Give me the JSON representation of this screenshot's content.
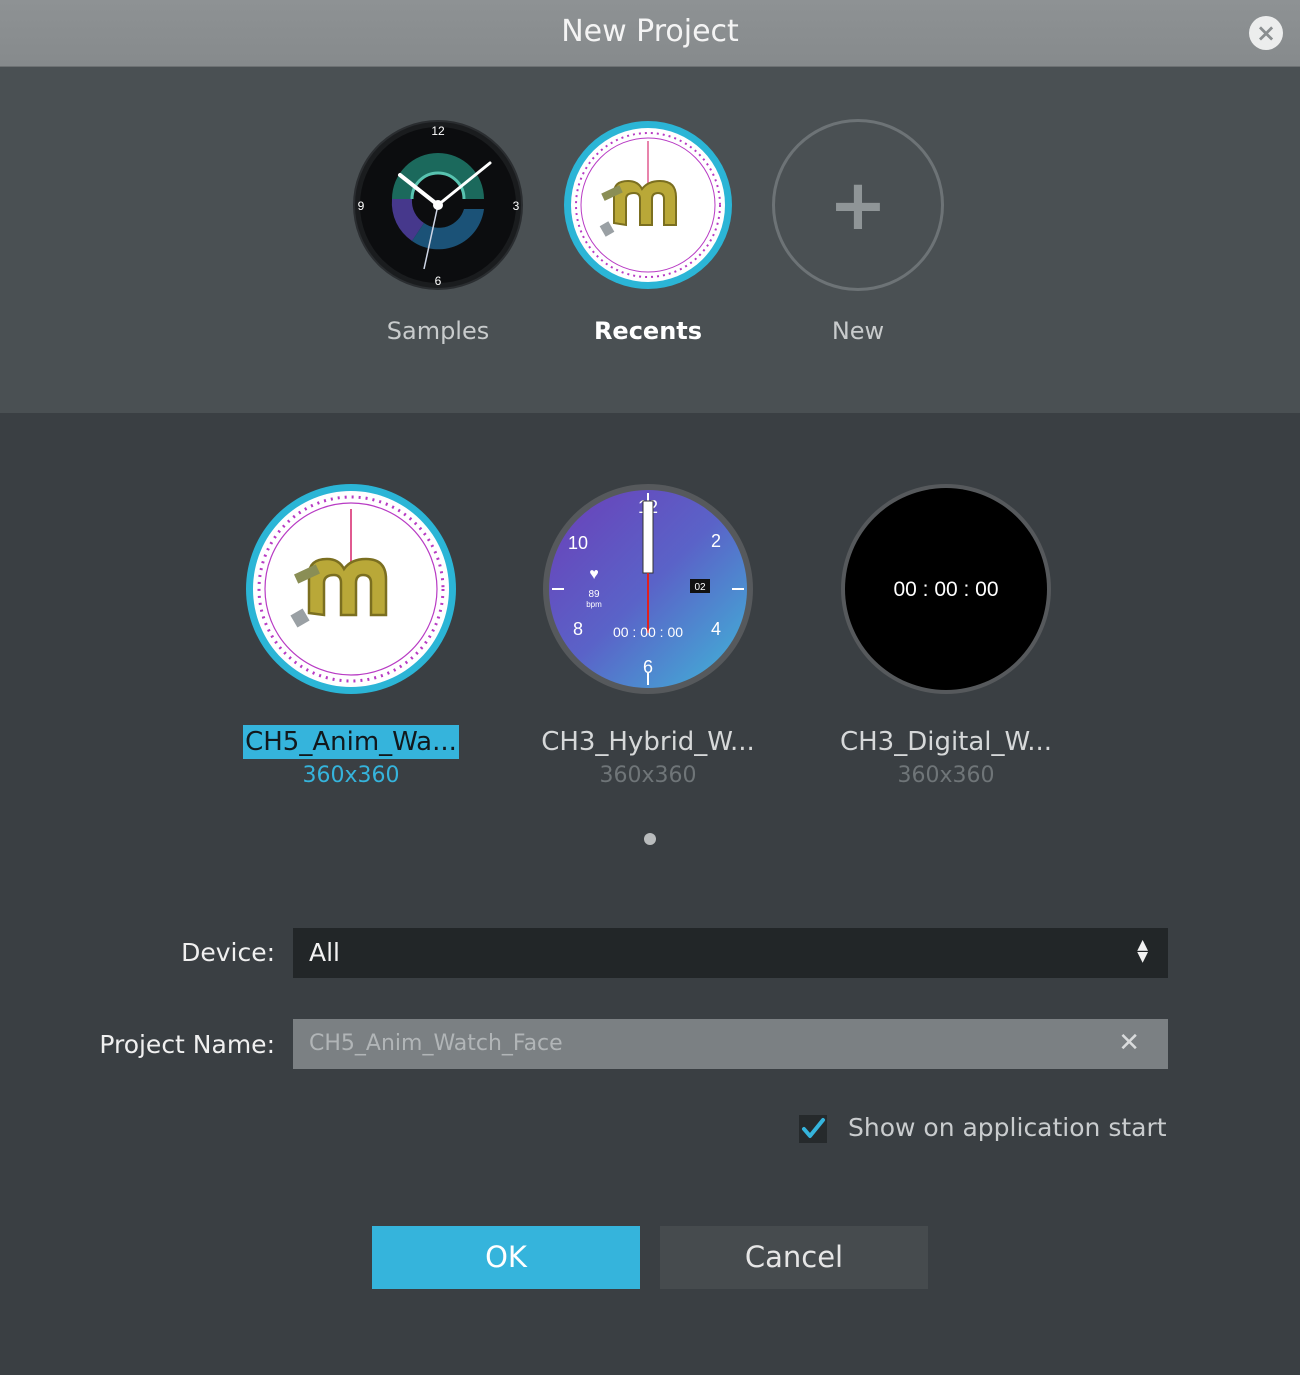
{
  "window": {
    "title": "New Project",
    "close_icon": "×"
  },
  "categories": [
    {
      "label": "Samples",
      "icon": "sample-watch-icon"
    },
    {
      "label": "Recents",
      "icon": "recent-watch-icon",
      "selected": true
    },
    {
      "label": "New",
      "icon": "plus-icon",
      "glyph": "+"
    }
  ],
  "projects": [
    {
      "name": "CH5_Anim_Wa...",
      "size": "360x360",
      "selected": true
    },
    {
      "name": "CH3_Hybrid_W...",
      "size": "360x360",
      "time": "00 : 00 : 00",
      "bpm": "89",
      "bpm_unit": "bpm",
      "date": "02"
    },
    {
      "name": "CH3_Digital_W...",
      "size": "360x360",
      "time": "00 : 00 : 00"
    }
  ],
  "form": {
    "device_label": "Device:",
    "device_value": "All",
    "project_name_label": "Project Name:",
    "project_name_placeholder": "CH5_Anim_Watch_Face",
    "clear_glyph": "✕",
    "show_on_start_label": "Show on application start",
    "show_on_start_checked": true
  },
  "buttons": {
    "ok": "OK",
    "cancel": "Cancel"
  },
  "colors": {
    "accent": "#35b4dc",
    "title_bar": "#8a8e90",
    "panel": "#4a5053",
    "background": "#3a3f43"
  }
}
